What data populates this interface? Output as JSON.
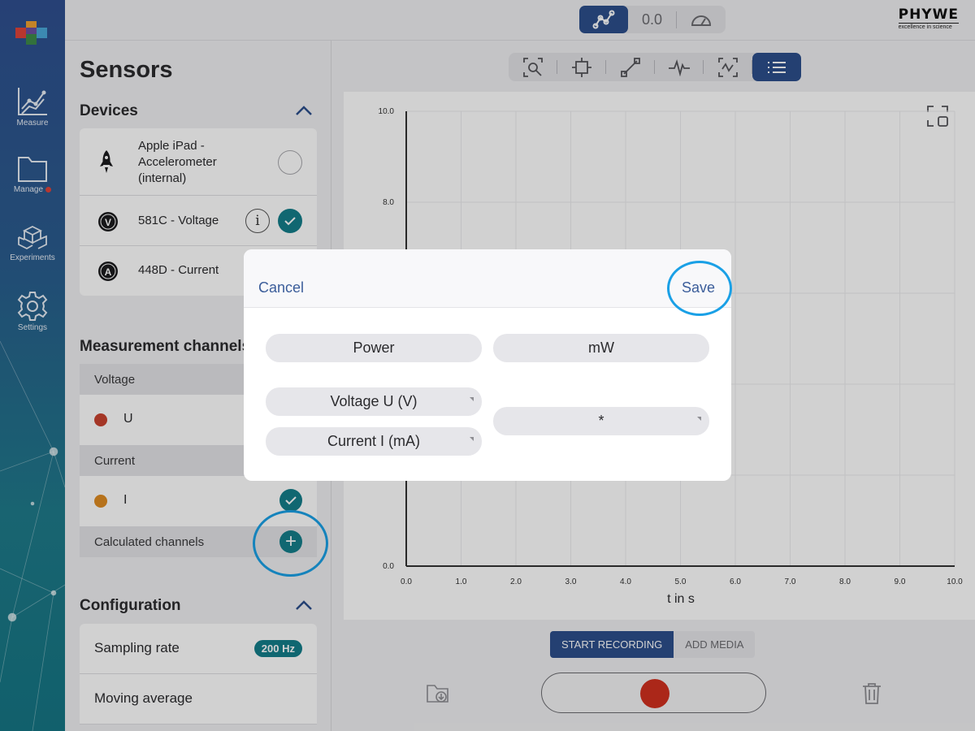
{
  "rail": {
    "items": [
      {
        "label": "Measure",
        "icon": "chart-icon"
      },
      {
        "label": "Manage",
        "icon": "folder-icon",
        "badge": true
      },
      {
        "label": "Experiments",
        "icon": "cubes-icon"
      },
      {
        "label": "Settings",
        "icon": "gear-icon"
      }
    ]
  },
  "topbar": {
    "value_display": "0.0",
    "brand_name": "PHYWE",
    "brand_tagline": "excellence in science"
  },
  "sensors": {
    "title": "Sensors",
    "devices_title": "Devices",
    "devices": [
      {
        "label": "Apple iPad -\nAccelerometer\n(internal)",
        "icon": "rocket-icon",
        "selected": false
      },
      {
        "label": "581C - Voltage",
        "icon": "V",
        "selected": true
      },
      {
        "label": "448D - Current",
        "icon": "A",
        "selected": false
      }
    ],
    "channels_title": "Measurement channels",
    "voltage_header": "Voltage",
    "voltage_channel": "U",
    "current_header": "Current",
    "current_channel": "I",
    "calculated_header": "Calculated channels",
    "config_title": "Configuration",
    "sampling_rate_label": "Sampling rate",
    "sampling_rate_value": "200 Hz",
    "moving_average_label": "Moving average",
    "colors": {
      "voltage": "#c9422f",
      "current": "#de8b22",
      "accent": "#147e8a",
      "nav": "#2c4f8c"
    }
  },
  "chart_data": {
    "type": "line",
    "xlabel": "t in s",
    "xlim": [
      0,
      10
    ],
    "ylim": [
      0,
      10
    ],
    "x_ticks": [
      "0.0",
      "1.0",
      "2.0",
      "3.0",
      "4.0",
      "5.0",
      "6.0",
      "7.0",
      "8.0",
      "9.0",
      "10.0"
    ],
    "y_ticks_visible": [
      "10.0",
      "8.0",
      "0.0"
    ],
    "series": []
  },
  "recording": {
    "start_label": "START RECORDING",
    "media_label": "ADD MEDIA"
  },
  "modal": {
    "cancel": "Cancel",
    "save": "Save",
    "name_value": "Power",
    "unit_value": "mW",
    "operand1": "Voltage U (V)",
    "operand2": "Current I (mA)",
    "operator": "*"
  }
}
